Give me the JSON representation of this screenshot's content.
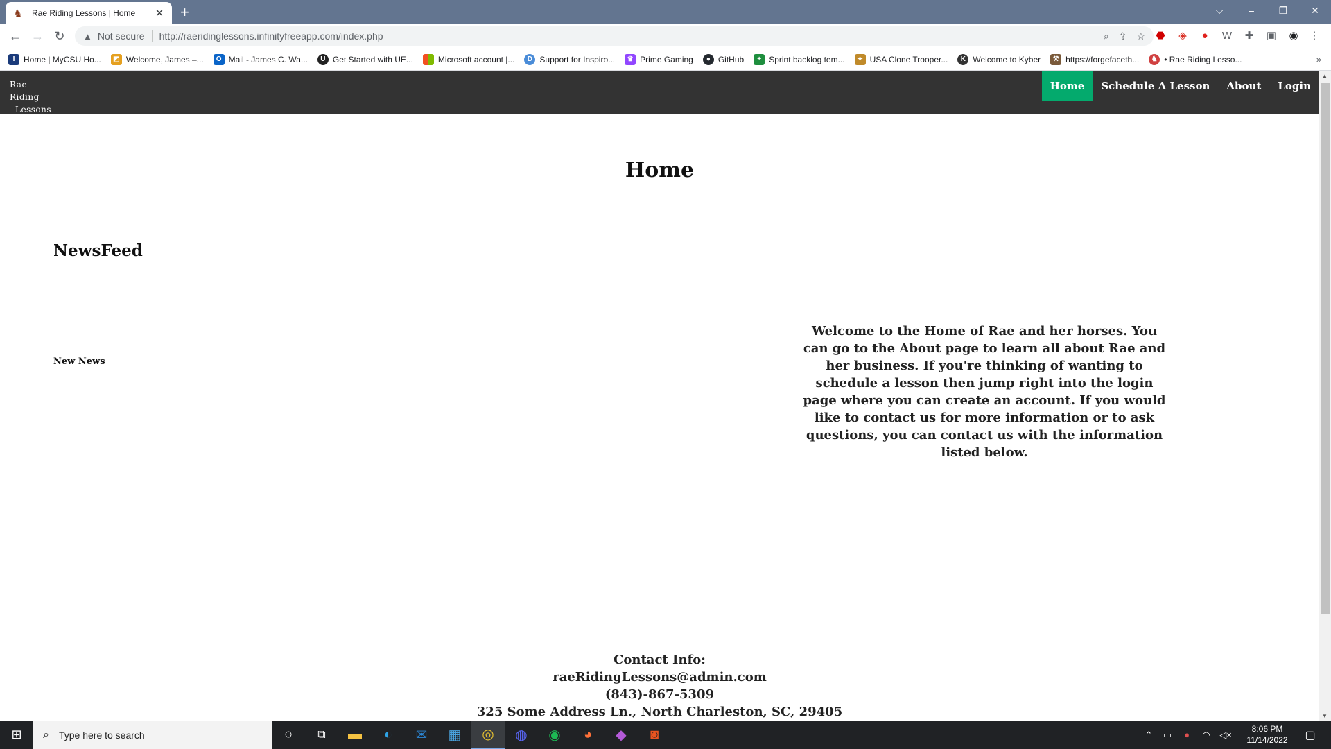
{
  "browser": {
    "tab_title": "Rae Riding Lessons | Home",
    "tab_close": "✕",
    "new_tab": "+",
    "address_warning": "Not secure",
    "url": "http://raeridinglessons.infinityfreeapp.com/index.php",
    "window_controls": {
      "dropdown": "⌵",
      "minimize": "–",
      "restore": "❐",
      "close": "✕"
    }
  },
  "bookmarks": [
    {
      "label": "Home | MyCSU Ho...",
      "icon": "csu-icon",
      "color": "#1a3a7a"
    },
    {
      "label": "Welcome, James –...",
      "icon": "canvas-icon",
      "color": "#e5a020"
    },
    {
      "label": "Mail - James C. Wa...",
      "icon": "outlook-icon",
      "color": "#0a64c8"
    },
    {
      "label": "Get Started with UE...",
      "icon": "unreal-icon",
      "color": "#222222"
    },
    {
      "label": "Microsoft account |...",
      "icon": "microsoft-icon",
      "color": "#f25022"
    },
    {
      "label": "Support for Inspiro...",
      "icon": "dell-icon",
      "color": "#4a8cd8"
    },
    {
      "label": "Prime Gaming",
      "icon": "prime-gaming-icon",
      "color": "#9146ff"
    },
    {
      "label": "GitHub",
      "icon": "github-icon",
      "color": "#24292f"
    },
    {
      "label": "Sprint backlog tem...",
      "icon": "sheets-icon",
      "color": "#1e8e3e"
    },
    {
      "label": "USA Clone Trooper...",
      "icon": "trooper-icon",
      "color": "#c08a2a"
    },
    {
      "label": "Welcome to Kyber",
      "icon": "kyber-icon",
      "color": "#333333"
    },
    {
      "label": "https://forgefaceth...",
      "icon": "forge-icon",
      "color": "#7a5a3a"
    },
    {
      "label": "• Rae Riding Lesso...",
      "icon": "rae-icon",
      "color": "#d04040"
    }
  ],
  "bookmarks_more": "»",
  "site": {
    "logo_line1": "Rae Riding",
    "logo_line2": "Lessons",
    "nav": [
      {
        "label": "Home",
        "active": true
      },
      {
        "label": "Schedule A Lesson",
        "active": false
      },
      {
        "label": "About",
        "active": false
      },
      {
        "label": "Login",
        "active": false
      }
    ],
    "nav_active_color": "#04aa6d",
    "page_title": "Home",
    "newsfeed_title": "NewsFeed",
    "news_items": [
      "New News"
    ],
    "welcome_text": "Welcome to the Home of Rae and her horses. You can go to the About page to learn all about Rae and her business. If you're thinking of wanting to schedule a lesson then jump right into the login page where you can create an account. If you would like to contact us for more information or to ask questions, you can contact us with the information listed below.",
    "contact": {
      "heading": "Contact Info:",
      "email": "raeRidingLessons@admin.com",
      "phone": "(843)-867-5309",
      "address": "325 Some Address Ln., North Charleston, SC, 29405"
    }
  },
  "taskbar": {
    "search_placeholder": "Type here to search",
    "time": "8:06 PM",
    "date": "11/14/2022"
  }
}
